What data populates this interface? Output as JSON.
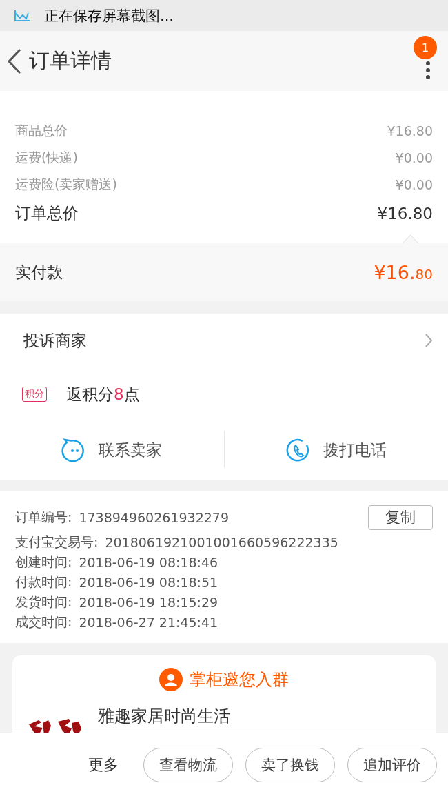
{
  "status_bar": {
    "text": "正在保存屏幕截图..."
  },
  "nav": {
    "title": "订单详情",
    "badge": "1"
  },
  "price": {
    "rows": [
      {
        "label": "商品总价",
        "value": "¥16.80",
        "kind": "minor"
      },
      {
        "label": "运费(快递)",
        "value": "¥0.00",
        "kind": "minor"
      },
      {
        "label": "运费险(卖家赠送)",
        "value": "¥0.00",
        "kind": "minor"
      },
      {
        "label": "订单总价",
        "value": "¥16.80",
        "kind": "total"
      }
    ],
    "paid": {
      "label": "实付款",
      "value_main": "¥16.",
      "value_cents": "80"
    }
  },
  "service": {
    "complaint": "投诉商家",
    "points_tag": "积分",
    "points_prefix": "返积分",
    "points_value": "8",
    "points_suffix": "点",
    "actions": [
      {
        "label": "联系卖家",
        "kind": "chat"
      },
      {
        "label": "拨打电话",
        "kind": "phone"
      }
    ]
  },
  "info": {
    "copy_button": "复制",
    "rows": [
      {
        "label": "订单编号:",
        "value": "173894960261932279"
      },
      {
        "label": "支付宝交易号:",
        "value": "2018061921001001660596222335"
      },
      {
        "label": "创建时间:",
        "value": "2018-06-19 08:18:46"
      },
      {
        "label": "付款时间:",
        "value": "2018-06-19 08:18:51"
      },
      {
        "label": "发货时间:",
        "value": "2018-06-19 18:15:29"
      },
      {
        "label": "成交时间:",
        "value": "2018-06-27 21:45:41"
      }
    ]
  },
  "group": {
    "title": "掌柜邀您入群",
    "shop_name": "雅趣家居时尚生活"
  },
  "bottom_bar": {
    "more": "更多",
    "buttons": [
      "查看物流",
      "卖了换钱",
      "追加评价"
    ]
  }
}
